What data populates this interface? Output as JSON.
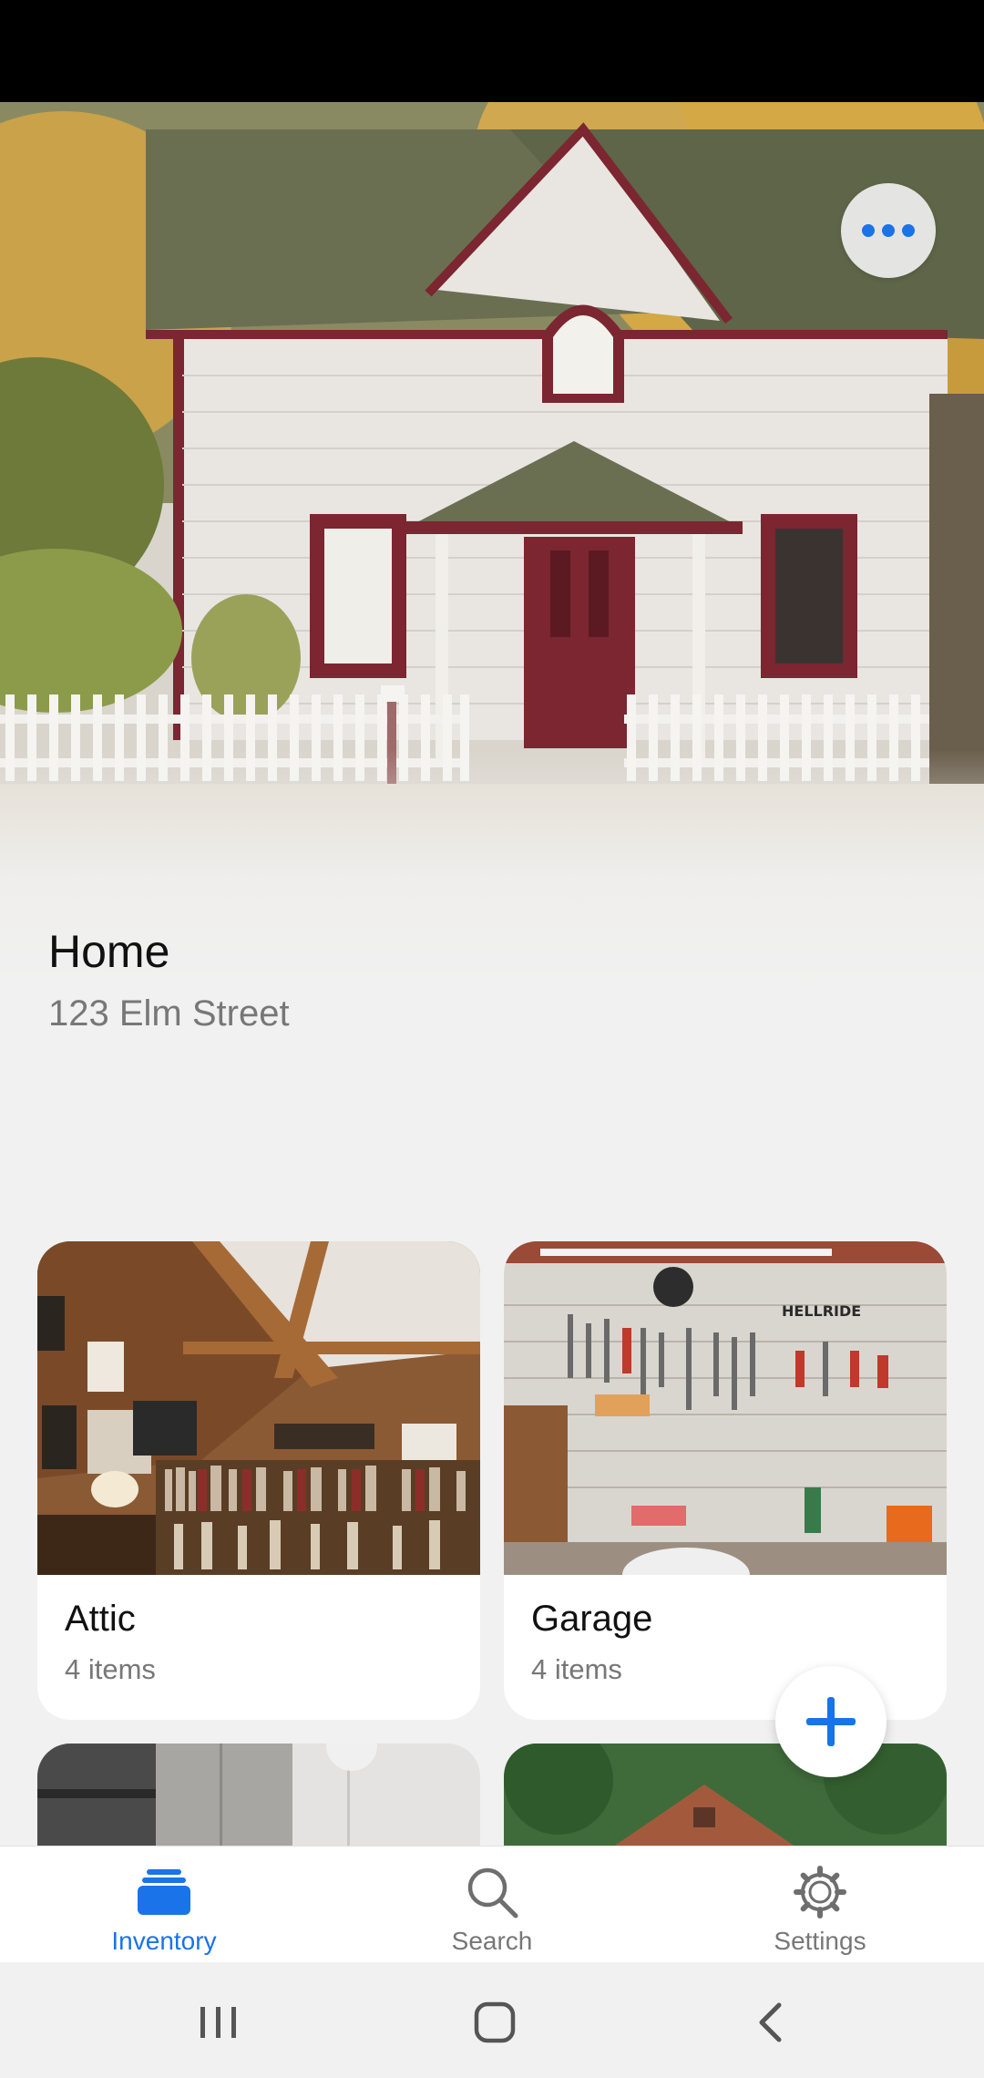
{
  "place": {
    "title": "Home",
    "address": "123 Elm Street"
  },
  "header": {
    "more_icon": "more-horizontal-icon"
  },
  "rooms": [
    {
      "name": "Attic",
      "count": "4 items"
    },
    {
      "name": "Garage",
      "count": "4 items"
    }
  ],
  "fab": {
    "icon": "plus-icon"
  },
  "bottom_nav": {
    "items": [
      {
        "label": "Inventory",
        "icon": "inventory-stack-icon",
        "active": true
      },
      {
        "label": "Search",
        "icon": "search-icon",
        "active": false
      },
      {
        "label": "Settings",
        "icon": "gear-icon",
        "active": false
      }
    ]
  },
  "system_nav": {
    "recents_icon": "recents-icon",
    "home_icon": "home-icon",
    "back_icon": "back-icon"
  },
  "colors": {
    "accent": "#1a73e8",
    "background": "#f1f1f1",
    "muted_text": "#777777"
  }
}
